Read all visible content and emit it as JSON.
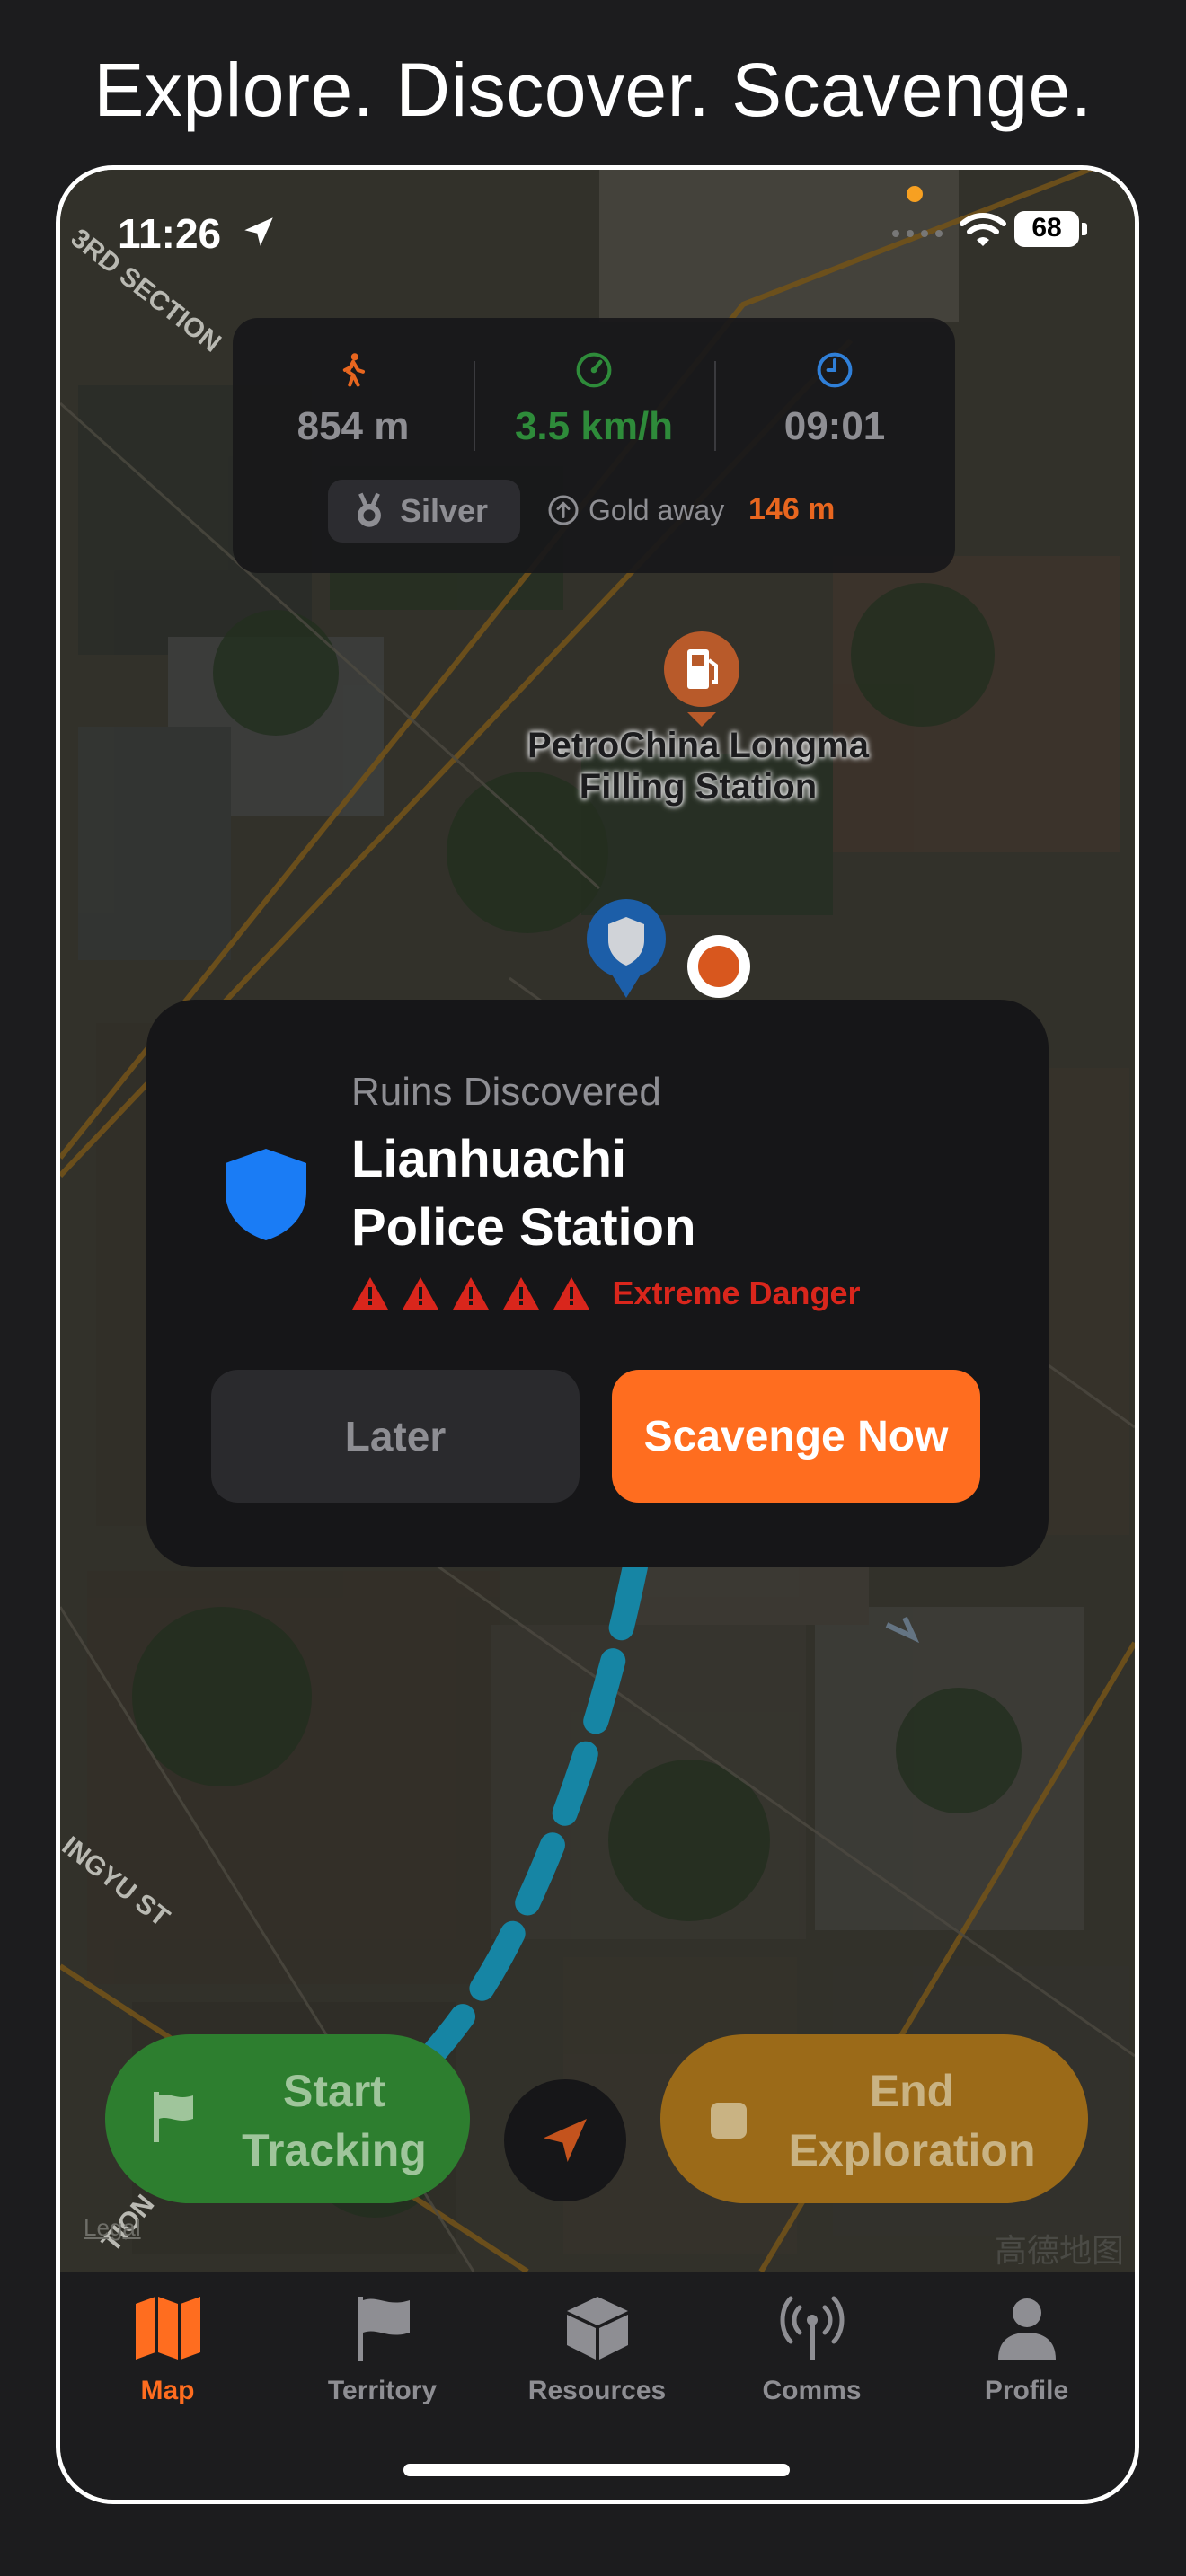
{
  "headline": "Explore. Discover. Scavenge.",
  "status_bar": {
    "time": "11:26",
    "battery": "68"
  },
  "stats": {
    "distance": "854 m",
    "speed": "3.5 km/h",
    "duration": "09:01",
    "tier": "Silver",
    "next_tier_label": "Gold away",
    "next_tier_distance": "146 m",
    "colors": {
      "distance": "#8e8e93",
      "speed": "#2e8b3a",
      "duration": "#8e8e93",
      "accent": "#e8661f"
    }
  },
  "map": {
    "poi_name_line1": "PetroChina Longma",
    "poi_name_line2": "Filling Station",
    "street_1": "3RD SECTION",
    "street_2": "INGYU ST",
    "street_3": "TION",
    "legal": "Legal",
    "provider": "高德地图"
  },
  "discovery": {
    "subtitle": "Ruins Discovered",
    "title_line1": "Lianhuachi",
    "title_line2": "Police Station",
    "danger_level": 5,
    "danger_text": "Extreme Danger",
    "later_label": "Later",
    "scavenge_label": "Scavenge Now"
  },
  "controls": {
    "start_line1": "Start",
    "start_line2": "Tracking",
    "end_line1": "End",
    "end_line2": "Exploration"
  },
  "tabs": [
    {
      "label": "Map",
      "icon": "map-icon",
      "active": true
    },
    {
      "label": "Territory",
      "icon": "flag-icon",
      "active": false
    },
    {
      "label": "Resources",
      "icon": "box-icon",
      "active": false
    },
    {
      "label": "Comms",
      "icon": "antenna-icon",
      "active": false
    },
    {
      "label": "Profile",
      "icon": "person-icon",
      "active": false
    }
  ],
  "colors": {
    "brand": "#ff6d1f",
    "danger": "#d9261c",
    "shield": "#1a7cf5",
    "track": "#1ba3c8"
  }
}
